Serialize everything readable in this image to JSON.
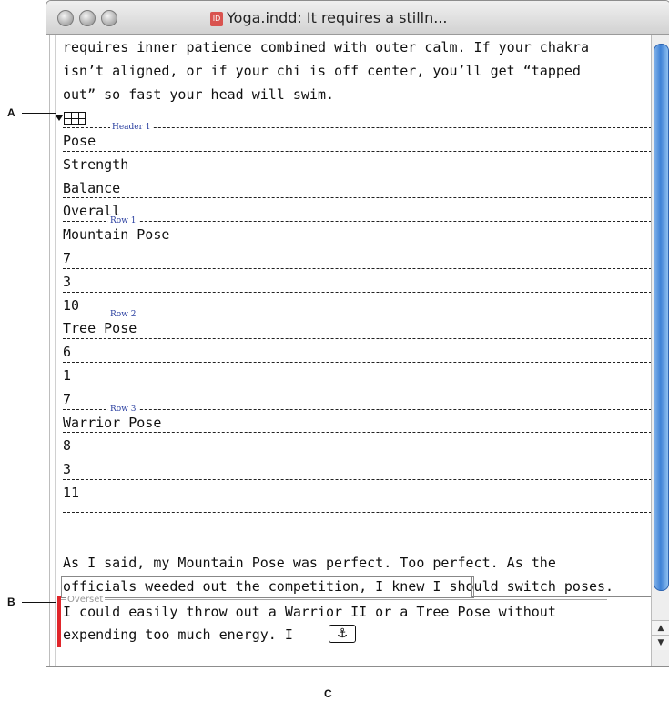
{
  "window": {
    "title": "Yoga.indd: It requires a stilln...",
    "doc_icon_label": "ID"
  },
  "story": {
    "intro_lines": [
      "requires inner patience combined with outer calm. If your chakra",
      "isn’t aligned, or if your chi is off center, you’ll get “tapped",
      "out” so fast your head will swim."
    ],
    "cells": [
      {
        "value": "Pose",
        "tag": "Header 1"
      },
      {
        "value": "Strength",
        "tag": ""
      },
      {
        "value": "Balance",
        "tag": ""
      },
      {
        "value": "Overall",
        "tag": ""
      },
      {
        "value": "Mountain Pose",
        "tag": "Row 1"
      },
      {
        "value": "7",
        "tag": ""
      },
      {
        "value": "3",
        "tag": ""
      },
      {
        "value": "10",
        "tag": ""
      },
      {
        "value": "Tree Pose",
        "tag": "Row 2"
      },
      {
        "value": "6",
        "tag": ""
      },
      {
        "value": "1",
        "tag": ""
      },
      {
        "value": "7",
        "tag": ""
      },
      {
        "value": "Warrior Pose",
        "tag": "Row 3"
      },
      {
        "value": "8",
        "tag": ""
      },
      {
        "value": "3",
        "tag": ""
      },
      {
        "value": "11",
        "tag": ""
      }
    ],
    "after_lines": [
      "As I said, my Mountain Pose was perfect. Too perfect. As the",
      "officials weeded out the competition, I knew I should switch poses."
    ],
    "overset_label": "Overset",
    "overset_lines": [
      "I could easily throw out a Warrior II or a Tree Pose without",
      "expending too much energy. I"
    ],
    "anchor_icon": "anchor-icon"
  },
  "callouts": {
    "a": "A",
    "b": "B",
    "c": "C"
  }
}
